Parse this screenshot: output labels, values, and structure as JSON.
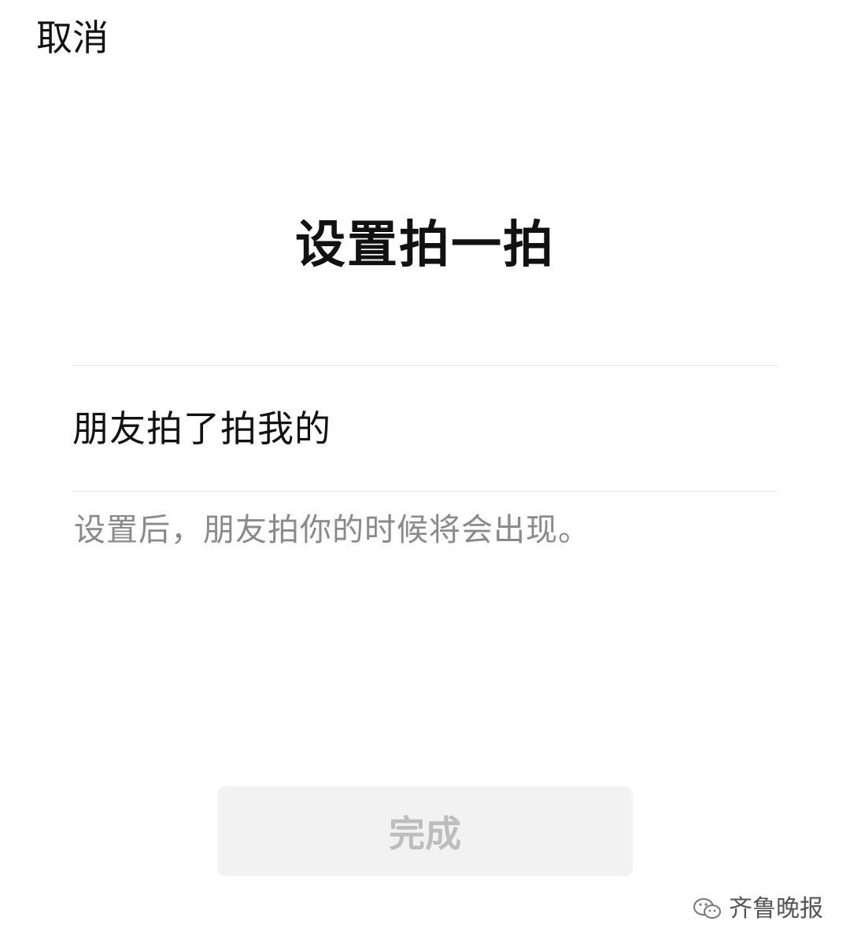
{
  "header": {
    "cancel_label": "取消"
  },
  "main": {
    "title": "设置拍一拍",
    "input_value": "朋友拍了拍我的",
    "hint": "设置后，朋友拍你的时候将会出现。"
  },
  "footer": {
    "done_label": "完成"
  },
  "watermark": {
    "icon": "wechat-icon",
    "text": "齐鲁晚报"
  },
  "colors": {
    "background": "#ffffff",
    "text_primary": "#111111",
    "text_hint": "#8a8a8a",
    "button_disabled_bg": "#f2f2f2",
    "button_disabled_text": "#bdbdbd",
    "divider": "#e5e5e5"
  }
}
